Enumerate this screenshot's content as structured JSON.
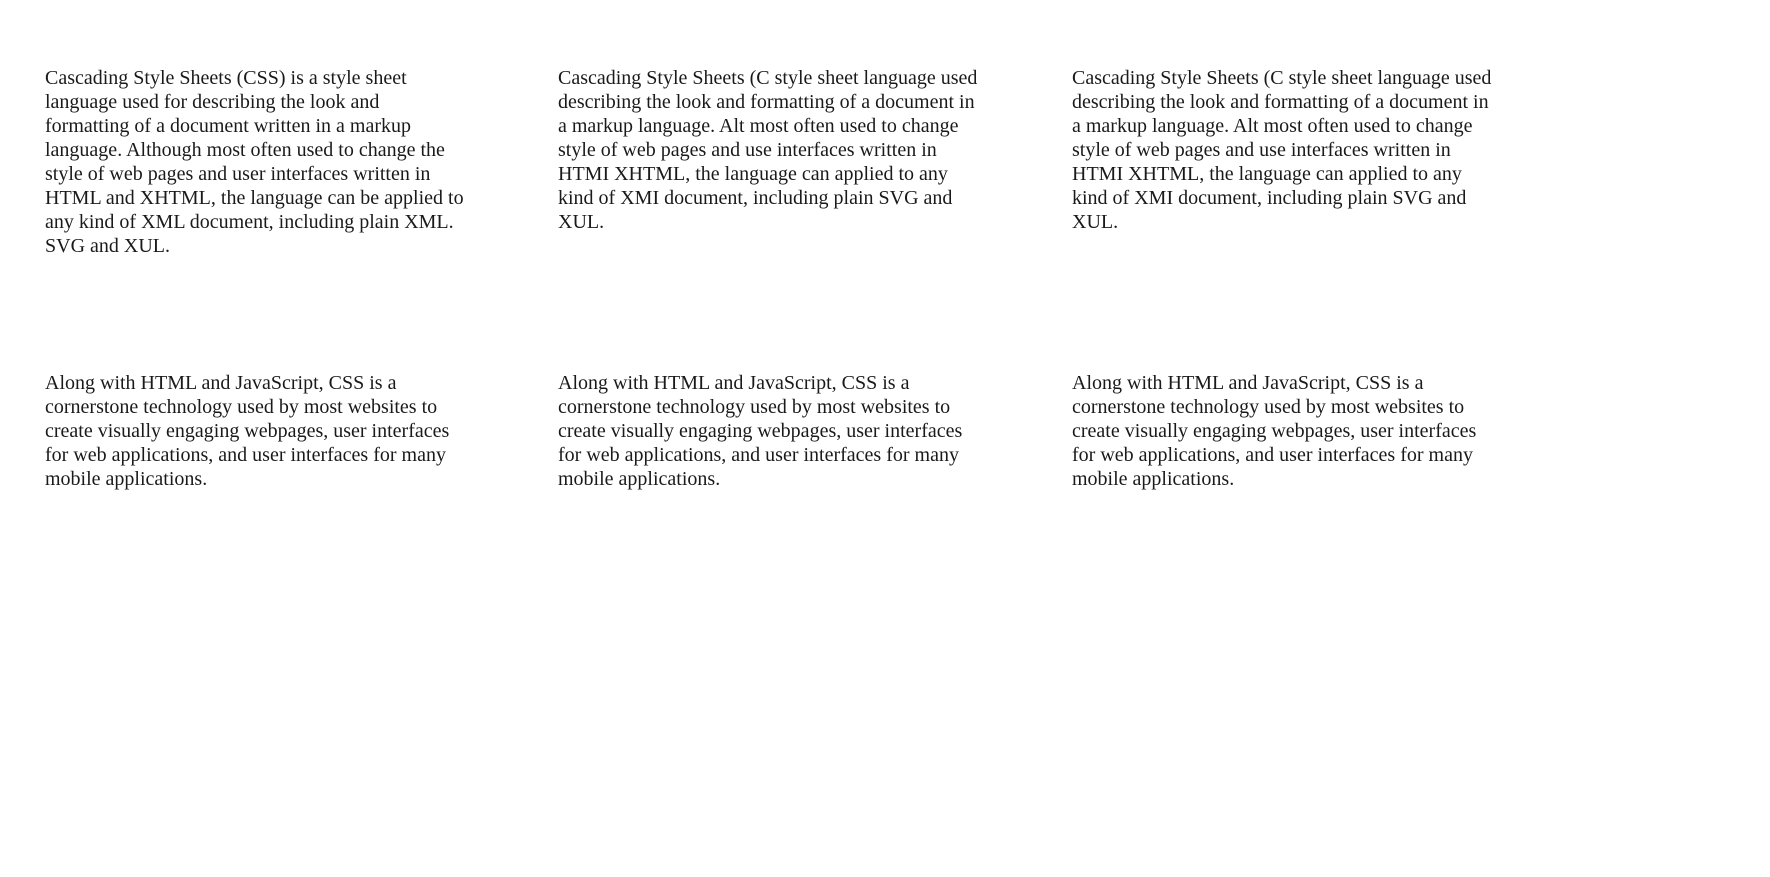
{
  "row1": {
    "col1": {
      "lines": [
        "Cascading Style Sheets (CSS) is a style sheet",
        "language used for describing the look and",
        "formatting of a document written in a markup",
        "language. Although most often used to change the",
        "style of web pages and user interfaces written in",
        "HTML and XHTML, the language can be applied to",
        "any kind of XML document, including plain XML.",
        "SVG and XUL."
      ]
    },
    "col2": {
      "lines": [
        "Cascading Style Sheets (C style sheet language used",
        "describing the look and formatting of a document in",
        "a markup language. Alt most often used to change",
        "style of web pages and use interfaces written in",
        "HTMI XHTML, the language can applied to any",
        "kind of XMI document, including plain SVG and",
        "XUL."
      ]
    },
    "col3": {
      "lines": [
        "Cascading Style Sheets (C style sheet language used",
        "describing the look and formatting of a document in",
        "a markup language. Alt most often used to change",
        "style of web pages and use interfaces written in",
        "HTMI XHTML, the language can applied to any",
        "kind of XMI document, including plain SVG and",
        "XUL."
      ]
    }
  },
  "row2": {
    "col1": {
      "lines": [
        "Along with HTML and JavaScript, CSS is a",
        "cornerstone technology used by most websites to",
        "create visually engaging webpages, user interfaces",
        "for web applications, and user interfaces for many",
        "mobile applications."
      ]
    },
    "col2": {
      "lines": [
        "Along with HTML and JavaScript, CSS is a",
        "cornerstone technology used by most websites to",
        "create visually engaging webpages, user interfaces",
        "for web applications, and user interfaces for many",
        "mobile applications."
      ]
    },
    "col3": {
      "lines": [
        "Along with HTML and JavaScript, CSS is a",
        "cornerstone technology used by most websites to",
        "create visually engaging webpages, user interfaces",
        "for web applications, and user interfaces for many",
        "mobile applications."
      ]
    }
  }
}
